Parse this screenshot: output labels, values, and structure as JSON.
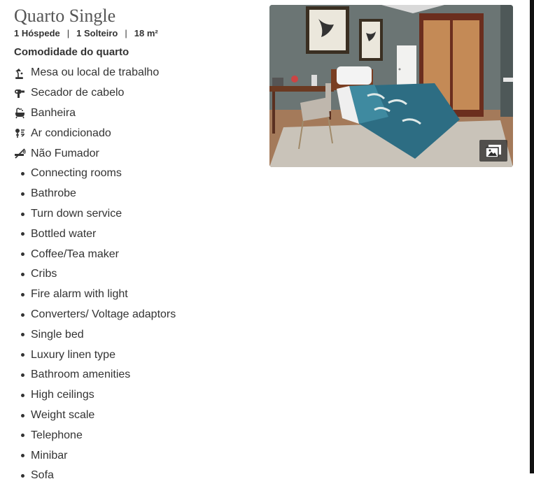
{
  "room": {
    "title": "Quarto Single",
    "guests": "1 Hóspede",
    "bed": "1 Solteiro",
    "size": "18 m²",
    "separator": "|"
  },
  "amenities_title": "Comodidade do quarto",
  "icon_amenities": [
    {
      "label": "Mesa ou local de trabalho",
      "icon": "desk-lamp-icon"
    },
    {
      "label": "Secador de cabelo",
      "icon": "hair-dryer-icon"
    },
    {
      "label": "Banheira",
      "icon": "bathtub-icon"
    },
    {
      "label": "Ar condicionado",
      "icon": "air-conditioning-icon"
    },
    {
      "label": "Não Fumador",
      "icon": "no-smoking-icon"
    }
  ],
  "amenities": [
    "Connecting rooms",
    "Bathrobe",
    "Turn down service",
    "Bottled water",
    "Coffee/Tea maker",
    "Cribs",
    "Fire alarm with light",
    "Converters/ Voltage adaptors",
    "Single bed",
    "Luxury linen type",
    "Bathroom amenities",
    "High ceilings",
    "Weight scale",
    "Telephone",
    "Minibar",
    "Sofa"
  ],
  "photo": {
    "gallery_icon": "photo-gallery-icon"
  }
}
